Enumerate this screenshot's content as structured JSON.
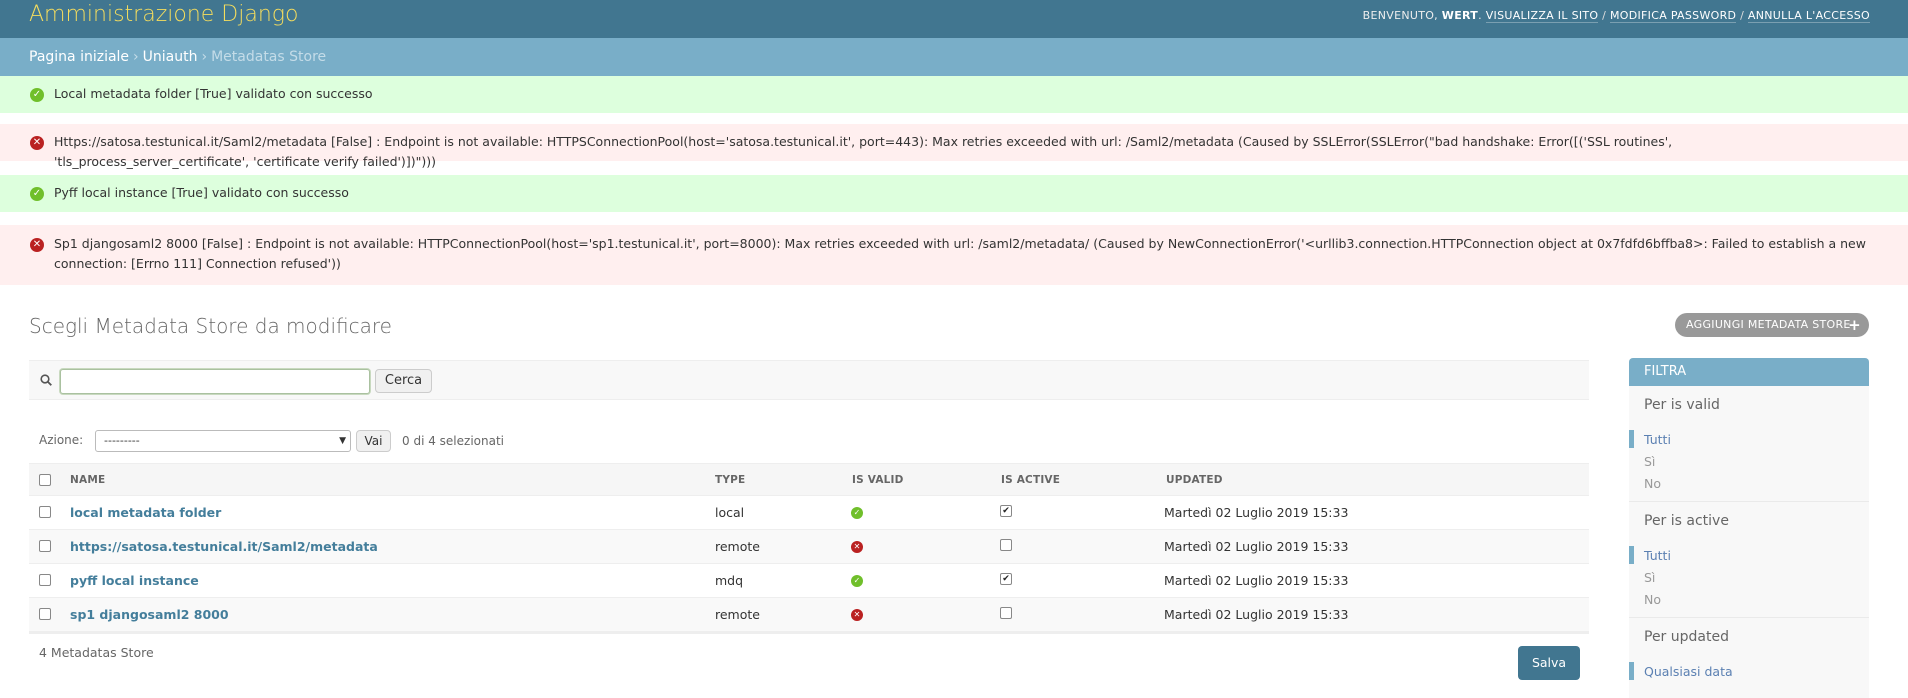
{
  "header": {
    "brand": "Amministrazione Django",
    "welcome": "BENVENUTO,",
    "username": "WERT",
    "links": [
      "VISUALIZZA IL SITO",
      "MODIFICA PASSWORD",
      "ANNULLA L'ACCESSO"
    ]
  },
  "breadcrumbs": {
    "home": "Pagina iniziale",
    "app": "Uniauth",
    "current": "Metadatas Store"
  },
  "messages": [
    {
      "type": "success",
      "text": "Local metadata folder [True] validato con successo"
    },
    {
      "type": "error",
      "text": "Https://satosa.testunical.it/Saml2/metadata [False] : Endpoint is not available: HTTPSConnectionPool(host='satosa.testunical.it', port=443): Max retries exceeded with url: /Saml2/metadata (Caused by SSLError(SSLError(\"bad handshake: Error([('SSL routines', 'tls_process_server_certificate', 'certificate verify failed')])\")))"
    },
    {
      "type": "success",
      "text": "Pyff local instance [True] validato con successo"
    },
    {
      "type": "error",
      "text": "Sp1 djangosaml2 8000 [False] : Endpoint is not available: HTTPConnectionPool(host='sp1.testunical.it', port=8000): Max retries exceeded with url: /saml2/metadata/ (Caused by NewConnectionError('<urllib3.connection.HTTPConnection object at 0x7fdfd6bffba8>: Failed to establish a new connection: [Errno 111] Connection refused'))"
    }
  ],
  "content": {
    "title": "Scegli Metadata Store da modificare",
    "add_button": "AGGIUNGI METADATA STORE",
    "search_button": "Cerca",
    "search_value": "",
    "action_label": "Azione:",
    "action_selected": "---------",
    "go_button": "Vai",
    "selection_count": "0 di 4 selezionati"
  },
  "table": {
    "headers": [
      "NAME",
      "TYPE",
      "IS VALID",
      "IS ACTIVE",
      "UPDATED"
    ],
    "rows": [
      {
        "name": "local metadata folder",
        "type": "local",
        "is_valid": true,
        "is_active": true,
        "updated": "Martedì 02 Luglio 2019 15:33"
      },
      {
        "name": "https://satosa.testunical.it/Saml2/metadata",
        "type": "remote",
        "is_valid": false,
        "is_active": false,
        "updated": "Martedì 02 Luglio 2019 15:33"
      },
      {
        "name": "pyff local instance",
        "type": "mdq",
        "is_valid": true,
        "is_active": true,
        "updated": "Martedì 02 Luglio 2019 15:33"
      },
      {
        "name": "sp1 djangosaml2 8000",
        "type": "remote",
        "is_valid": false,
        "is_active": false,
        "updated": "Martedì 02 Luglio 2019 15:33"
      }
    ],
    "paginator": "4 Metadatas Store",
    "save_button": "Salva"
  },
  "filter": {
    "title": "FILTRA",
    "groups": [
      {
        "title": "Per is valid",
        "items": [
          "Tutti",
          "Sì",
          "No"
        ]
      },
      {
        "title": "Per is active",
        "items": [
          "Tutti",
          "Sì",
          "No"
        ]
      },
      {
        "title": "Per updated",
        "items": [
          "Qualsiasi data"
        ]
      }
    ]
  },
  "colors": {
    "header_bg": "#417690",
    "brand": "#f5dd5d",
    "breadcrumb_bg": "#79aec8",
    "success_bg": "#ddffdd",
    "error_bg": "#ffefef",
    "link": "#447e9b"
  }
}
